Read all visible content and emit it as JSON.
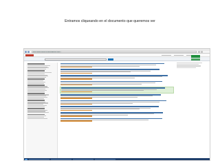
{
  "slide": {
    "title": "Entramos cliqueando en el documento que queremos ver"
  },
  "browser": {
    "url": "https://www.ncbi.nlm.nih.gov/pubmed/?term=..."
  },
  "taskbar": {
    "tasks": [
      "",
      "",
      "",
      ""
    ],
    "clock": ""
  },
  "colors": {
    "link": "#3b6ea5",
    "highlight": "#dff0d8",
    "green_button": "#1e8f3c",
    "taskbar": "#1f3f6b"
  }
}
